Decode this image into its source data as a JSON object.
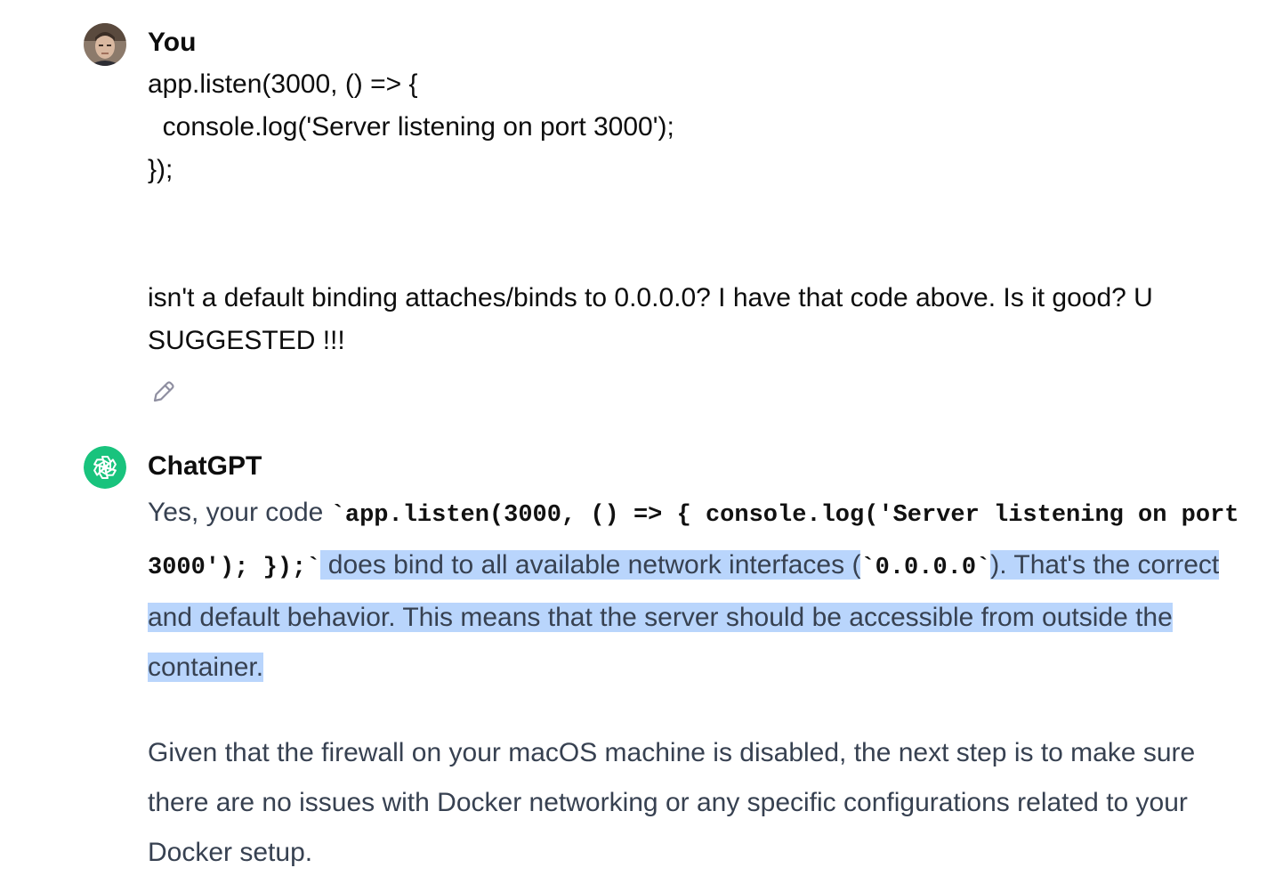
{
  "user_message": {
    "author": "You",
    "code_lines": [
      "app.listen(3000, () => {",
      "  console.log('Server listening on port 3000');",
      "});"
    ],
    "question": "isn't a default binding attaches/binds to 0.0.0.0? I have that code above. Is it good? U SUGGESTED !!!",
    "edit_icon": "pencil-icon"
  },
  "assistant_message": {
    "author": "ChatGPT",
    "avatar_icon": "openai-logo-icon",
    "avatar_color": "#19c37d",
    "p1_prefix": "Yes, your code ",
    "p1_code": "`app.listen(3000, () => { console.log('Server listening on port 3000'); });`",
    "p1_mid": " does bind to all available network interfaces (",
    "p1_code2": "`0.0.0.0`",
    "p1_suffix": "). That's the correct and default behavior. This means that the server should be accessible from outside the container.",
    "p2": "Given that the firewall on your macOS machine is disabled, the next step is to make sure there are no issues with Docker networking or any specific configurations related to your Docker setup."
  },
  "colors": {
    "selection_highlight": "#b9d5fc",
    "assistant_text": "#374151",
    "user_text": "#0d0d0d"
  }
}
